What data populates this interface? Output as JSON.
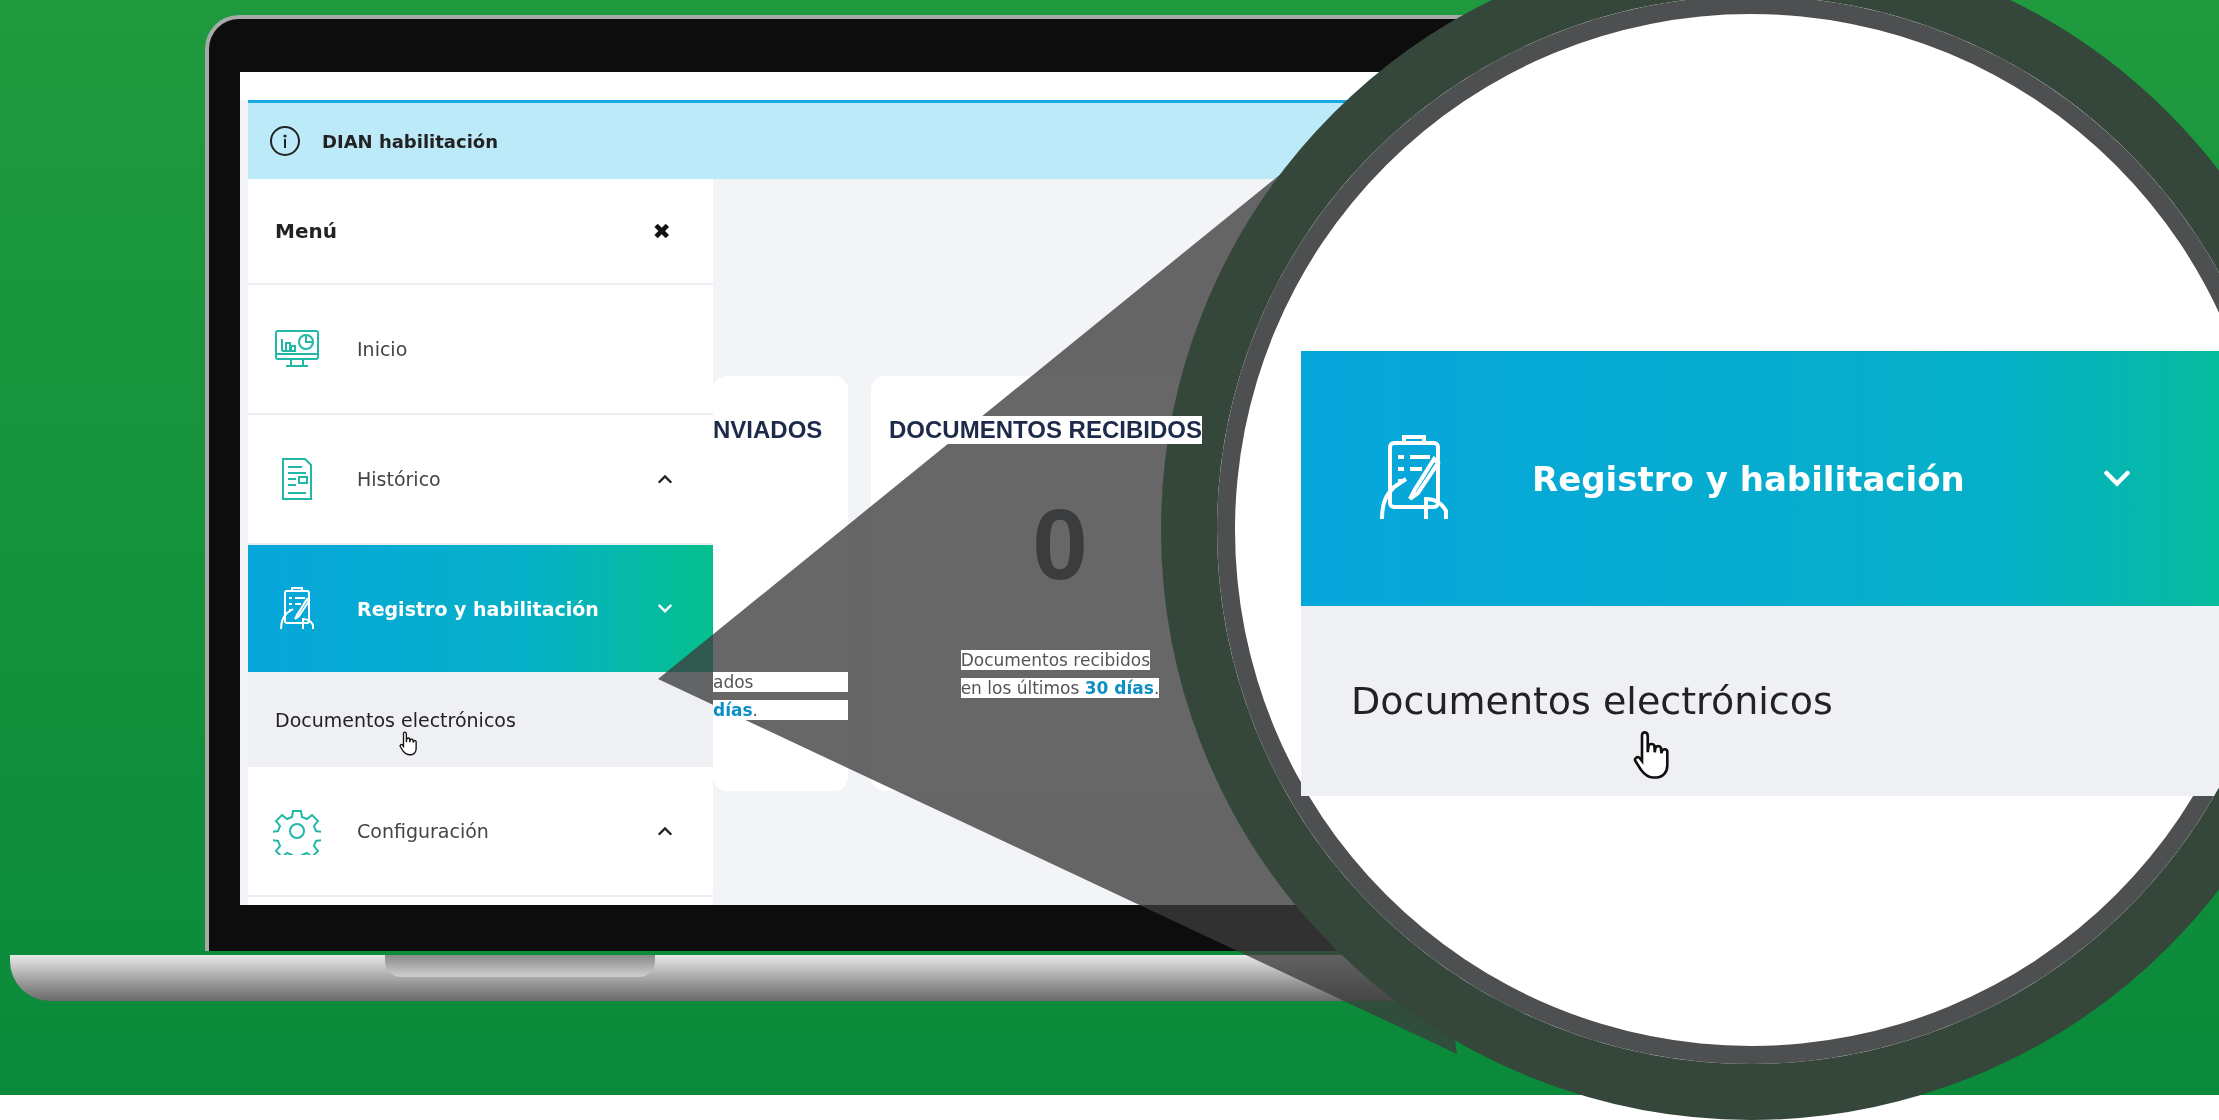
{
  "banner": {
    "title": "DIAN habilitación"
  },
  "menu": {
    "title": "Menú",
    "close": "✖",
    "items": [
      {
        "kind": "link",
        "label": "Inicio",
        "selected": false
      },
      {
        "kind": "group",
        "label": "Histórico",
        "selected": false,
        "expanded": false
      },
      {
        "kind": "group",
        "label": "Registro y habilitación",
        "selected": true,
        "expanded": true,
        "children": [
          {
            "label": "Documentos electrónicos"
          }
        ]
      },
      {
        "kind": "group",
        "label": "Configuración",
        "selected": false,
        "expanded": false
      }
    ]
  },
  "cards": [
    {
      "title": "NVIADOS",
      "lines": [
        "ados",
        "**días**."
      ]
    },
    {
      "title": "DOCUMENTOS RECIBIDOS",
      "value": "0",
      "lines": [
        "Documentos recibidos",
        "en los últimos **30 días**."
      ]
    }
  ],
  "magnifier": {
    "item": {
      "label": "Registro y habilitación",
      "selected": true,
      "expanded": true
    },
    "child": {
      "label": "Documentos electrónicos"
    }
  }
}
